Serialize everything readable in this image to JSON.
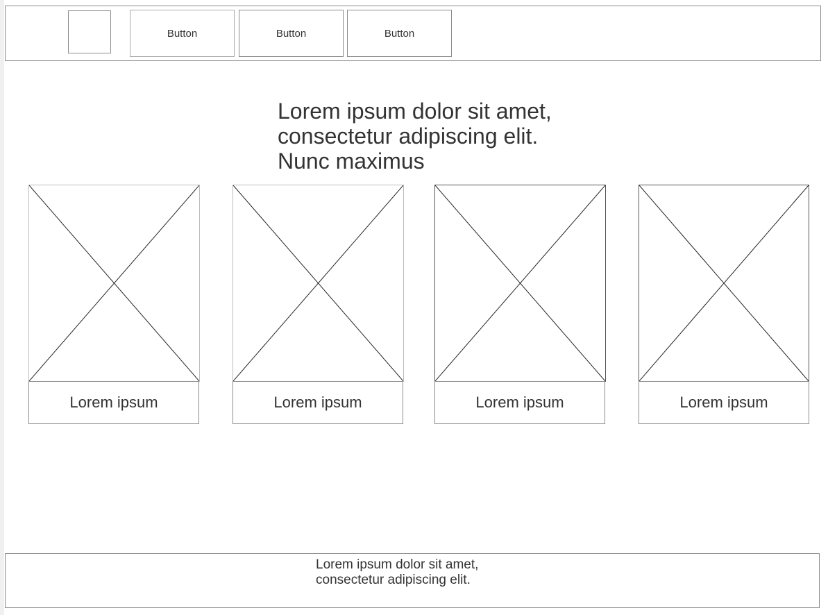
{
  "header": {
    "logo_placeholder": "logo-placeholder",
    "buttons": [
      {
        "label": "Button"
      },
      {
        "label": "Button"
      },
      {
        "label": "Button"
      }
    ]
  },
  "main": {
    "heading_lines": [
      "Lorem ipsum dolor sit amet,",
      "consectetur adipiscing elit.",
      "Nunc maximus"
    ],
    "cards": [
      {
        "caption": "Lorem ipsum"
      },
      {
        "caption": "Lorem ipsum"
      },
      {
        "caption": "Lorem ipsum"
      },
      {
        "caption": "Lorem ipsum"
      }
    ]
  },
  "footer": {
    "text_lines": [
      "Lorem ipsum dolor sit amet,",
      "consectetur adipiscing elit."
    ]
  }
}
